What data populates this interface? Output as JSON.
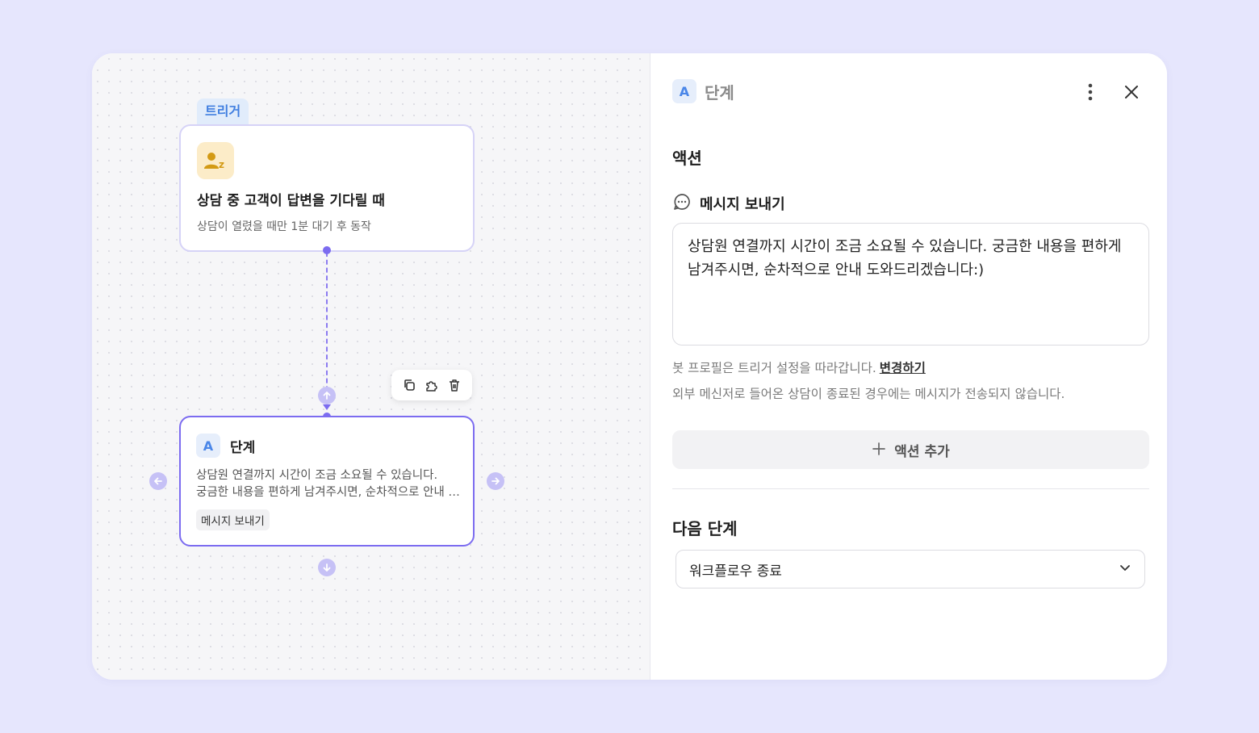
{
  "canvas": {
    "trigger_tag": "트리거",
    "trigger_node": {
      "title": "상담 중 고객이 답변을 기다릴 때",
      "subtitle": "상담이 열렸을 때만 1분 대기 후 동작",
      "icon": "user-z-icon"
    },
    "step_node": {
      "badge": "A",
      "title": "단계",
      "desc_line1": "상담원 연결까지 시간이 조금 소요될 수 있습니다.",
      "desc_line2": "궁금한 내용을 편하게 남겨주시면, 순차적으로 안내 도와드리겠습니다:)",
      "chip": "메시지 보내기"
    },
    "toolbar_icons": [
      "copy-icon",
      "puzzle-icon",
      "trash-icon"
    ]
  },
  "panel": {
    "badge": "A",
    "title": "단계",
    "action_section": "액션",
    "action_type": "메시지 보내기",
    "message": "상담원 연결까지 시간이 조금 소요될 수 있습니다. 궁금한 내용을 편하게 남겨주시면, 순차적으로 안내 도와드리겠습니다:)",
    "hint_bot_profile": "봇 프로필은 트리거 설정을 따라갑니다.",
    "hint_link": "변경하기",
    "hint_external": "외부 메신저로 들어온 상담이 종료된 경우에는 메시지가 전송되지 않습니다.",
    "add_action": "액션 추가",
    "next_step_section": "다음 단계",
    "next_step_value": "워크플로우 종료"
  },
  "colors": {
    "background": "#e6e6fd",
    "accent": "#7c6cf0",
    "trigger_tag_text": "#3f7ee0",
    "badge_text": "#4a86e8",
    "trigger_icon_bg": "#fcecc8"
  }
}
